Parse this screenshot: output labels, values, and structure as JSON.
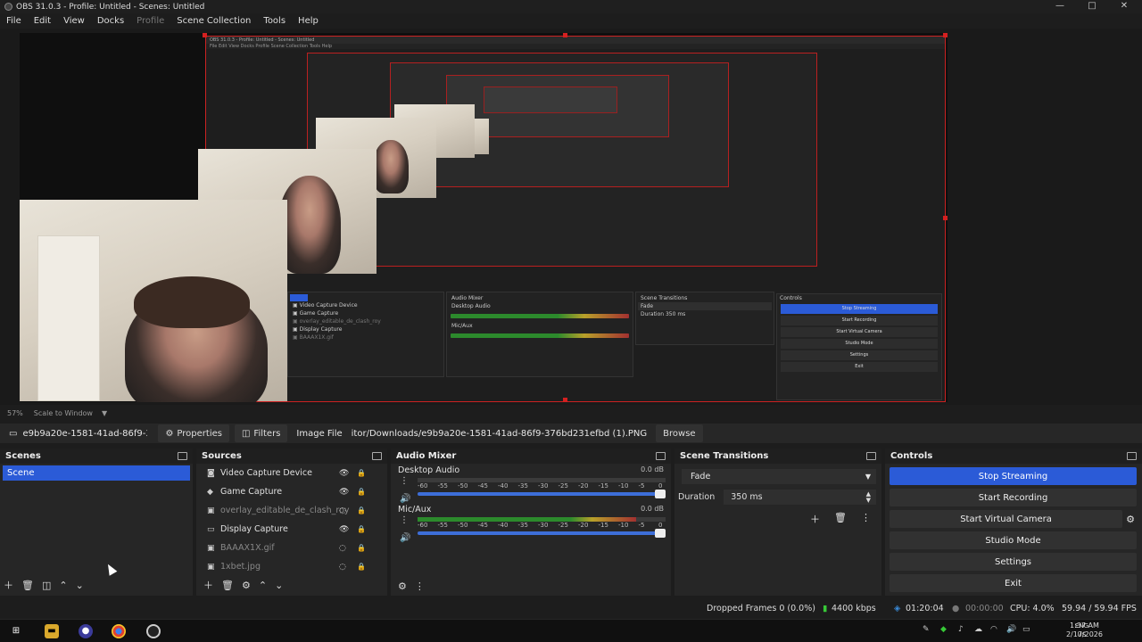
{
  "window": {
    "title": "OBS 31.0.3 - Profile: Untitled - Scenes: Untitled",
    "minimize": "—",
    "maximize": "□",
    "close": "✕"
  },
  "menu": {
    "file": "File",
    "edit": "Edit",
    "view": "View",
    "docks": "Docks",
    "profile": "Profile",
    "scene_collection": "Scene Collection",
    "tools": "Tools",
    "help": "Help"
  },
  "preview": {
    "nested_title": "OBS 31.0.3 - Profile: Untitled - Scenes: Untitled",
    "nested_menu": "File  Edit  View  Docks  Profile  Scene Collection  Tools  Help"
  },
  "zoom": {
    "percent": "57%",
    "mode": "Scale to Window"
  },
  "source_bar": {
    "selected_name": "e9b9a20e-1581-41ad-86f9-3",
    "properties": "Properties",
    "filters": "Filters",
    "image_file_label": "Image File",
    "path": "itor/Downloads/e9b9a20e-1581-41ad-86f9-376bd231efbd (1).PNG",
    "browse": "Browse"
  },
  "scenes": {
    "title": "Scenes",
    "items": [
      "Scene"
    ]
  },
  "sources": {
    "title": "Sources",
    "items": [
      {
        "name": "Video Capture Device",
        "icon": "camera-icon",
        "visible": true
      },
      {
        "name": "Game Capture",
        "icon": "gamepad-icon",
        "visible": true
      },
      {
        "name": "overlay_editable_de_clash_royale",
        "icon": "image-icon",
        "visible": false
      },
      {
        "name": "Display Capture",
        "icon": "monitor-icon",
        "visible": true
      },
      {
        "name": "BAAAX1X.gif",
        "icon": "image-icon",
        "visible": false
      },
      {
        "name": "1xbet.jpg",
        "icon": "image-icon",
        "visible": false
      }
    ]
  },
  "audio_mixer": {
    "title": "Audio Mixer",
    "channels": [
      {
        "name": "Desktop Audio",
        "db": "0.0 dB",
        "level": 0
      },
      {
        "name": "Mic/Aux",
        "db": "0.0 dB",
        "level": 0.88
      }
    ],
    "ticks": [
      "-60",
      "-55",
      "-50",
      "-45",
      "-40",
      "-35",
      "-30",
      "-25",
      "-20",
      "-15",
      "-10",
      "-5",
      "0"
    ]
  },
  "scene_transitions": {
    "title": "Scene Transitions",
    "transition": "Fade",
    "duration_label": "Duration",
    "duration_value": "350 ms"
  },
  "controls": {
    "title": "Controls",
    "stop_streaming": "Stop Streaming",
    "start_recording": "Start Recording",
    "start_virtual_camera": "Start Virtual Camera",
    "studio_mode": "Studio Mode",
    "settings": "Settings",
    "exit": "Exit"
  },
  "status": {
    "dropped_frames": "Dropped Frames 0 (0.0%)",
    "bitrate": "4400 kbps",
    "stream_time": "01:20:04",
    "record_time": "00:00:00",
    "cpu": "CPU: 4.0%",
    "fps": "59.94 / 59.94 FPS"
  },
  "taskbar": {
    "lang_top": "ENG",
    "lang_bottom": "US",
    "time": "1:37 AM",
    "date": "2/17/2026"
  },
  "colors": {
    "accent": "#2b5bd7",
    "live_red": "#d42020",
    "meter_green": "#2c8a2c",
    "meter_yellow": "#b8a02a",
    "meter_red": "#a23030"
  }
}
